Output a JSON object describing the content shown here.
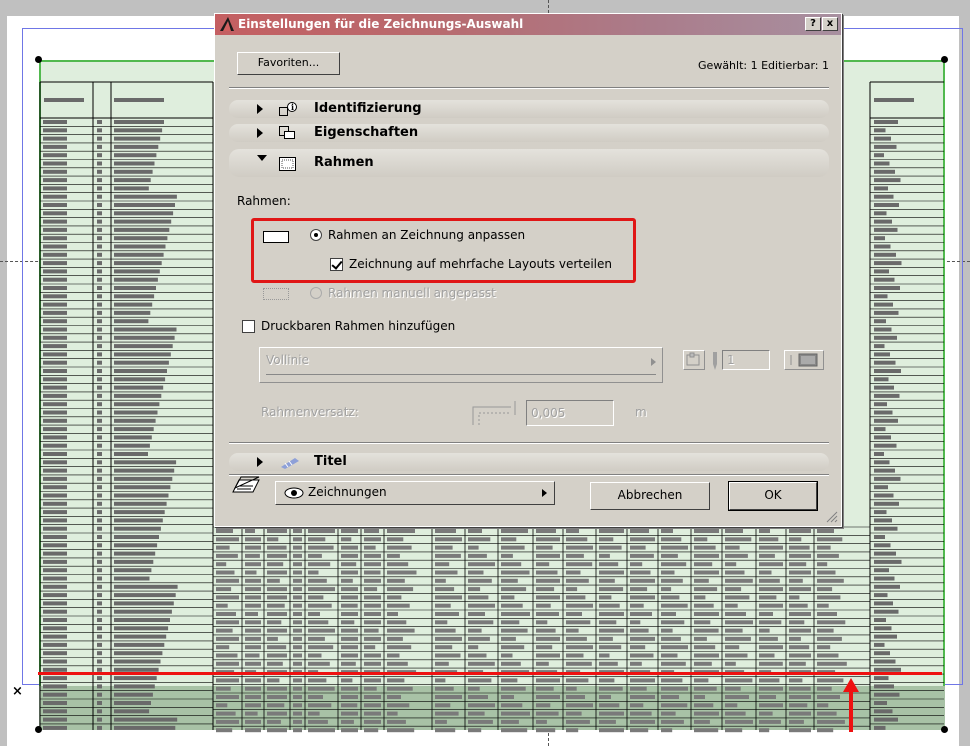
{
  "dialog": {
    "title": "Einstellungen für die Zeichnungs-Auswahl",
    "help_btn": "?",
    "close_btn": "x",
    "favorites_label": "Favoriten...",
    "selection_info": "Gewählt: 1 Editierbar: 1"
  },
  "sections": [
    {
      "label": "Identifizierung",
      "expanded": false,
      "icon": "id-info-icon"
    },
    {
      "label": "Eigenschaften",
      "expanded": false,
      "icon": "properties-icon"
    },
    {
      "label": "Rahmen",
      "expanded": true,
      "icon": "frame-icon"
    },
    {
      "label": "Titel",
      "expanded": false,
      "icon": "title-pen-icon"
    }
  ],
  "frame": {
    "heading": "Rahmen:",
    "option_fit": "Rahmen an Zeichnung anpassen",
    "option_distribute": "Zeichnung auf mehrfache Layouts verteilen",
    "option_manual": "Rahmen manuell angepasst",
    "printable_frame": "Druckbaren Rahmen hinzufügen",
    "line_type": "Vollinie",
    "pen_value": "1",
    "offset_label": "Rahmenversatz:",
    "offset_value": "0,005",
    "offset_unit": "m"
  },
  "footer": {
    "view_label": "Zeichnungen",
    "cancel_label": "Abbrechen",
    "ok_label": "OK"
  },
  "colors": {
    "highlight_red": "#e01616",
    "selection_green": "#52b94f",
    "frame_blue": "#6f76e6"
  }
}
